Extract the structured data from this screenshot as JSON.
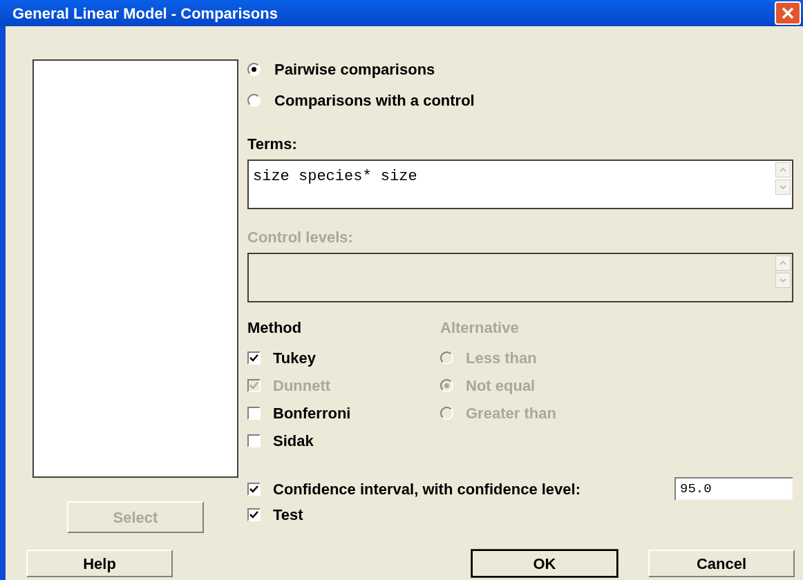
{
  "window": {
    "title": "General Linear Model - Comparisons"
  },
  "select_button": {
    "label": "Select",
    "disabled": true
  },
  "comparison_type": [
    {
      "label": "Pairwise comparisons",
      "selected": true
    },
    {
      "label": "Comparisons with a control",
      "selected": false
    }
  ],
  "terms": {
    "label": "Terms:",
    "value": "size species* size"
  },
  "control_levels": {
    "label": "Control levels:",
    "disabled": true
  },
  "method": {
    "label": "Method",
    "items": [
      {
        "label": "Tukey",
        "checked": true,
        "disabled": false
      },
      {
        "label": "Dunnett",
        "checked": true,
        "disabled": true
      },
      {
        "label": "Bonferroni",
        "checked": false,
        "disabled": false
      },
      {
        "label": "Sidak",
        "checked": false,
        "disabled": false
      }
    ]
  },
  "alternative": {
    "label": "Alternative",
    "disabled": true,
    "options": [
      {
        "label": "Less than",
        "selected": false
      },
      {
        "label": "Not equal",
        "selected": true
      },
      {
        "label": "Greater than",
        "selected": false
      }
    ]
  },
  "confidence": {
    "label": "Confidence interval, with confidence level:",
    "checked": true,
    "value": "95.0"
  },
  "test": {
    "label": "Test",
    "checked": true
  },
  "buttons": [
    {
      "label": "Help",
      "default": false
    },
    {
      "label": "OK",
      "default": true
    },
    {
      "label": "Cancel",
      "default": false
    }
  ]
}
